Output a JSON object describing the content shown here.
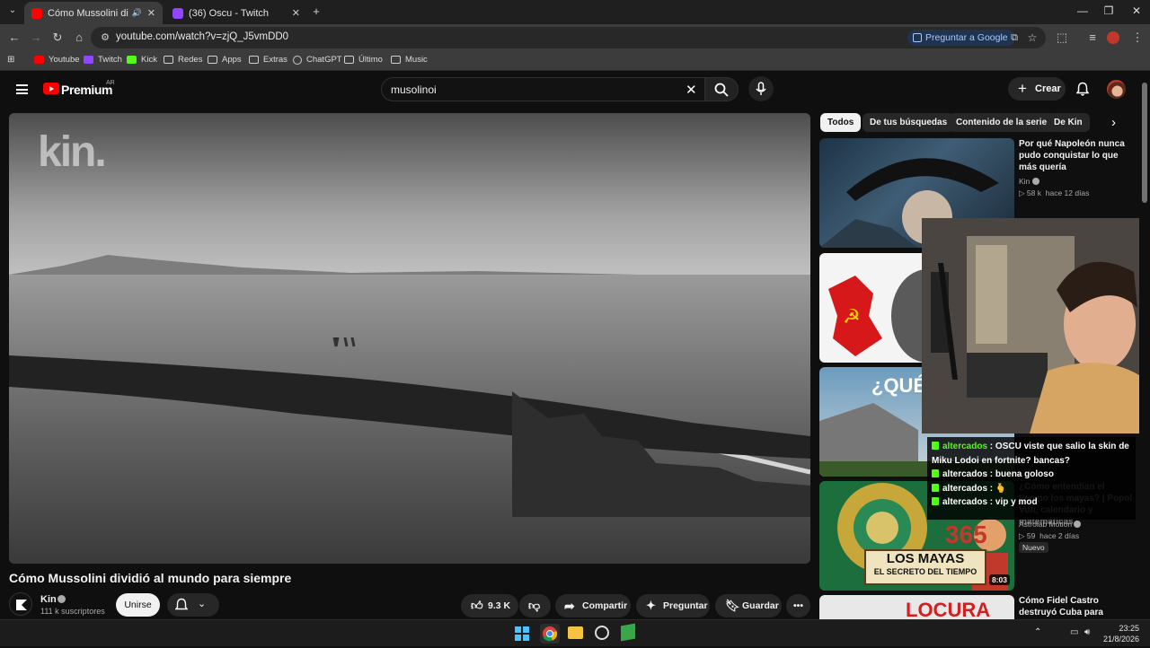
{
  "browser": {
    "tabs": [
      {
        "title": "Cómo Mussolini dividió al m",
        "active": true
      },
      {
        "title": "(36) Oscu - Twitch",
        "active": false
      }
    ],
    "url": "youtube.com/watch?v=zjQ_J5vmDD0",
    "ask_google": "Preguntar a Google",
    "bookmarks": [
      "Youtube",
      "Twitch",
      "Kick",
      "Redes",
      "Apps",
      "Extras",
      "ChatGPT",
      "Último",
      "Music"
    ]
  },
  "youtube": {
    "brand": "Premium",
    "country": "AR",
    "search": "musolinoi",
    "create": "Crear"
  },
  "video": {
    "watermark": "kin.",
    "title": "Cómo Mussolini dividió al mundo para siempre",
    "channel": "Kin",
    "subscribers": "111 k suscriptores",
    "join": "Unirse",
    "likes": "9.3 K",
    "share": "Compartir",
    "ask": "Preguntar",
    "save": "Guardar"
  },
  "chips": [
    "Todos",
    "De tus búsquedas",
    "Contenido de la serie",
    "De Kin"
  ],
  "recommendations": [
    {
      "title": "Por qué Napoleón nunca pudo conquistar lo que más quería",
      "channel": "Kin",
      "stats": "58 k",
      "age": "hace 12 días"
    },
    {
      "thumb_text": "¿QUÉ ES"
    },
    {
      "title": "¿Cómo entendían el tiempo los mayas? | Popol Vuh, calendario y matemáticas",
      "channel": "Astrolab Motion",
      "stats": "59",
      "age": "hace 2 días",
      "badge": "Nuevo",
      "duration": "8:03",
      "thumb_top": "365",
      "thumb_mid": "LOS MAYAS",
      "thumb_bot": "EL SECRETO DEL TIEMPO"
    },
    {
      "title": "Cómo Fidel Castro destruyó Cuba para siempre",
      "thumb_text": "LOCURA"
    }
  ],
  "chat": [
    {
      "user": "altercados",
      "msg": "OSCU viste que salio la skin de Miku Lodoi en fortnite? bancas?"
    },
    {
      "user": "altercados",
      "msg": "buena goloso"
    },
    {
      "user": "altercados",
      "msg": "🫰"
    },
    {
      "user": "altercados",
      "msg": "vip y mod"
    }
  ],
  "taskbar": {
    "time": "23:25",
    "date": "21/8/2026"
  },
  "colors": {
    "yt_red": "#ff0000",
    "kick_green": "#53fc18",
    "chrome_frame": "#1f1f1f"
  }
}
